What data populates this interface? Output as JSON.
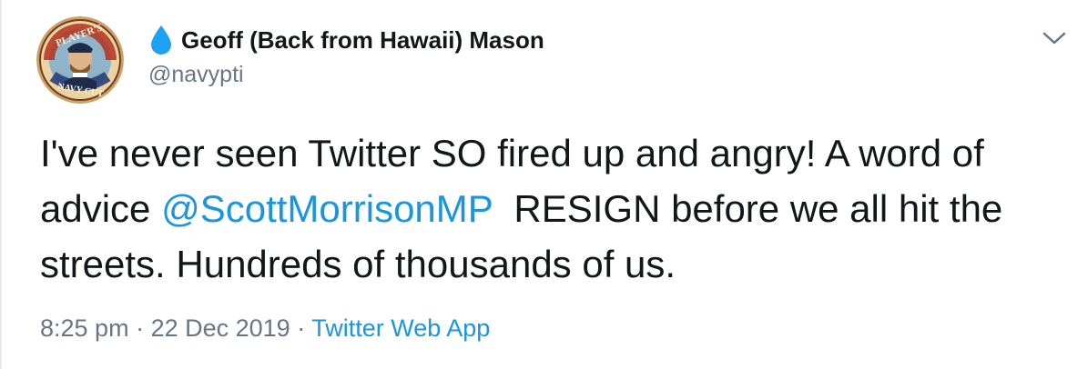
{
  "tweet": {
    "author": {
      "display_name": "Geoff (Back from Hawaii) Mason",
      "handle": "@navypti",
      "avatar_text_top": "PLAYER'S",
      "avatar_text_bottom": "NAVY CUT",
      "badge_icon": "water-drop-icon"
    },
    "text": {
      "line1": "I've never seen Twitter SO fired up and angry! A word of",
      "line2_before": "advice ",
      "mention": "@ScottMorrisonMP",
      "line2_after": "  RESIGN before we all hit the",
      "line3": "streets. Hundreds of thousands of us."
    },
    "meta": {
      "time": "8:25 pm",
      "separator": " · ",
      "date": "22 Dec 2019",
      "source": "Twitter Web App"
    },
    "menu_icon": "chevron-down-icon"
  },
  "colors": {
    "link": "#1b95e0",
    "secondary_text": "#657786",
    "primary_text": "#14171a",
    "drop": "#1da1f2"
  }
}
